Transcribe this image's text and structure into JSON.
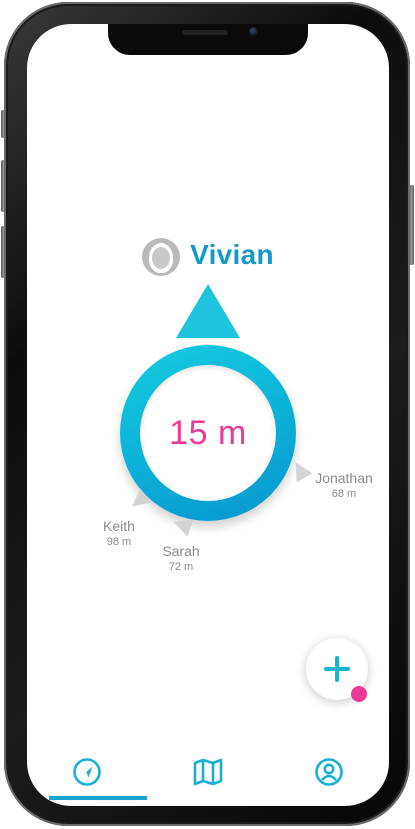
{
  "user": {
    "name": "Vivian",
    "distance": "15 m"
  },
  "nearby": [
    {
      "name": "Jonathan",
      "distance": "68 m"
    },
    {
      "name": "Keith",
      "distance": "98 m"
    },
    {
      "name": "Sarah",
      "distance": "72 m"
    }
  ],
  "fab": {
    "icon": "plus-icon",
    "has_notification": true
  },
  "nav": {
    "active_index": 0,
    "items": [
      {
        "icon": "navigation-icon"
      },
      {
        "icon": "map-icon"
      },
      {
        "icon": "profile-icon"
      }
    ]
  },
  "colors": {
    "accent": "#1aa2d2",
    "cyan": "#1ec4dd",
    "pink": "#ee3a96",
    "muted": "#8a8a8a"
  }
}
